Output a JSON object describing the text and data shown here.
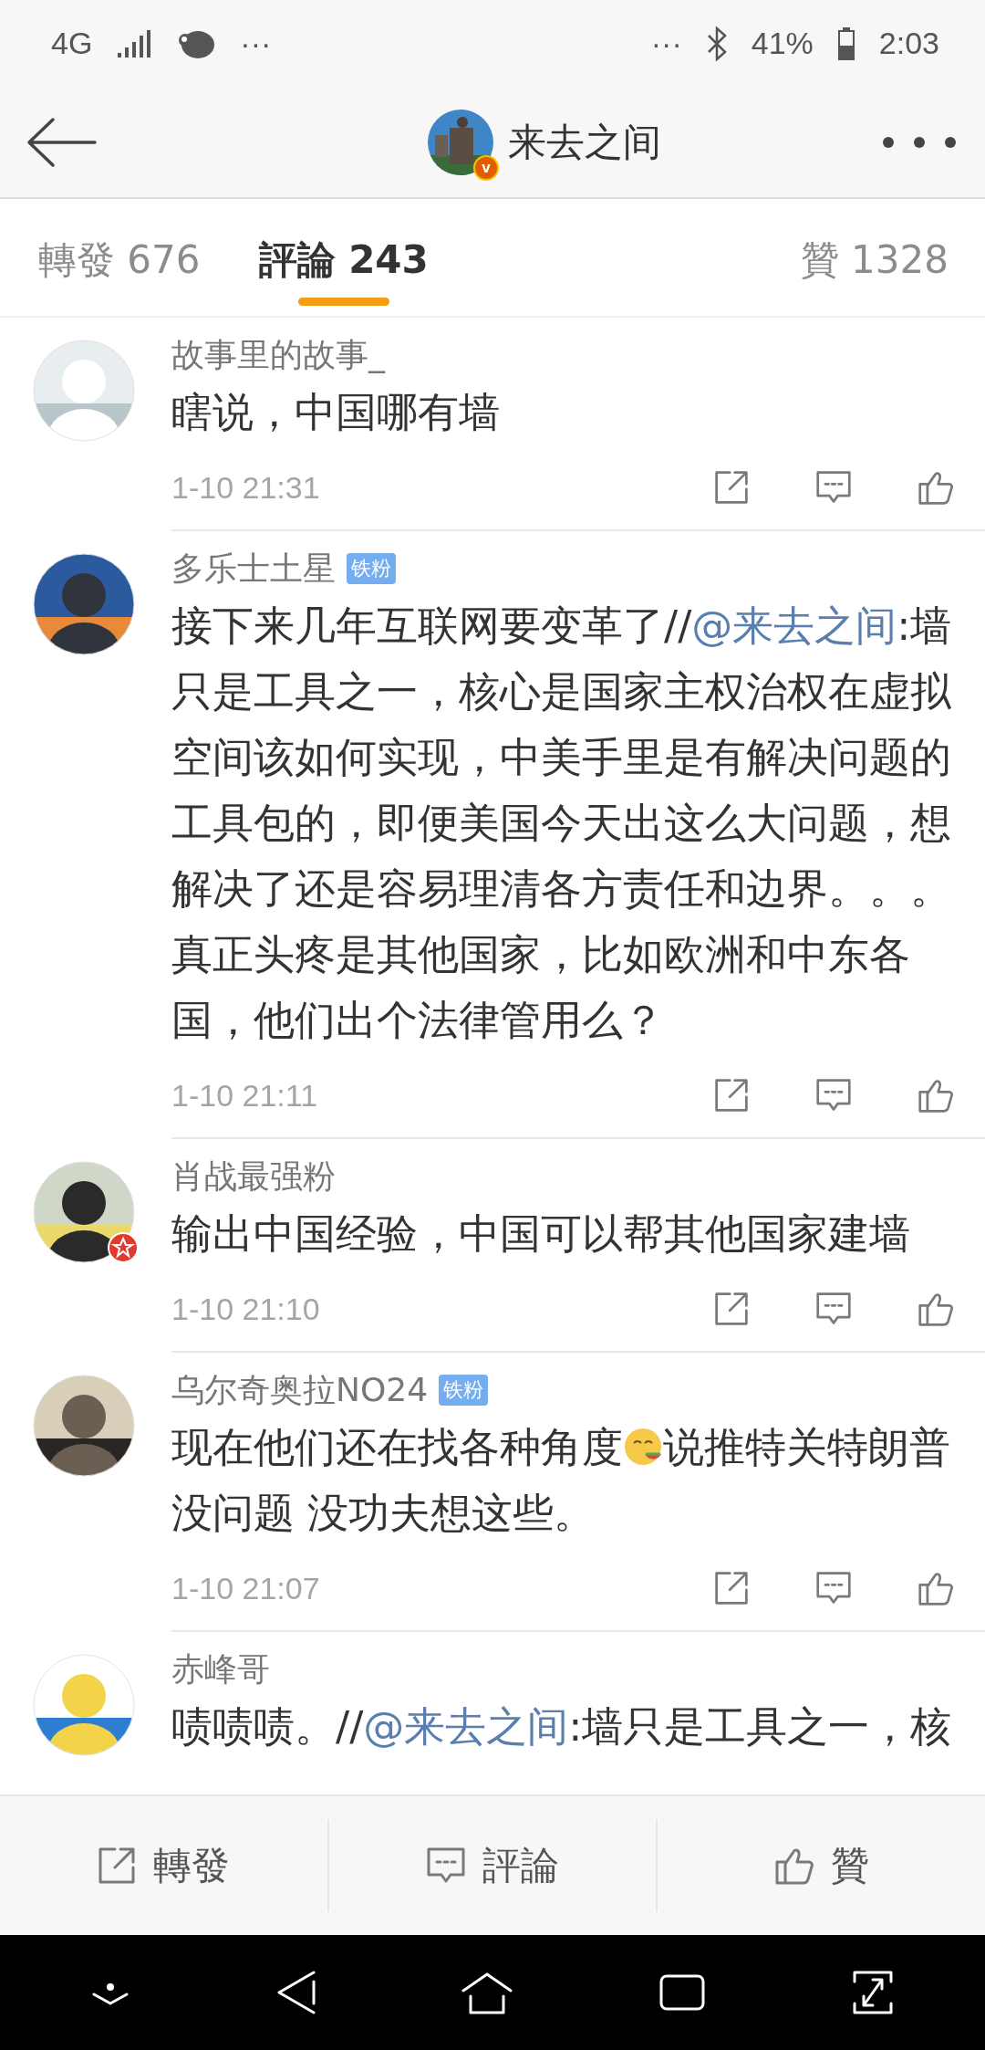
{
  "status_bar": {
    "network": "4G",
    "left_more": "···",
    "right_more": "···",
    "battery": "41%",
    "time": "2:03"
  },
  "header": {
    "title": "来去之间",
    "verified_mark": "v"
  },
  "tabs": [
    {
      "label": "轉發 676",
      "selected": false
    },
    {
      "label": "評論 243",
      "selected": true
    },
    {
      "label": "贊 1328",
      "selected": false
    }
  ],
  "comments": [
    {
      "name": "故事里的故事_",
      "avatar_badge": false,
      "time": "1-10 21:31",
      "body": [
        {
          "kind": "text",
          "text": "瞎说，中国哪有墙"
        }
      ]
    },
    {
      "name": "多乐士土星",
      "badge": "铁粉",
      "avatar_badge": false,
      "time": "1-10 21:11",
      "body": [
        {
          "kind": "text",
          "text": "接下来几年互联网要变革了//"
        },
        {
          "kind": "mention",
          "text": "@来去之间"
        },
        {
          "kind": "text",
          "text": ":墙只是工具之一，核心是国家主权治权在虚拟空间该如何实现，中美手里是有解决问题的工具包的，即便美国今天出这么大问题，想解决了还是容易理清各方责任和边界。。。真正头疼是其他国家，比如欧洲和中东各国，他们出个法律管用么？"
        }
      ]
    },
    {
      "name": "肖战最强粉",
      "avatar_badge": true,
      "time": "1-10 21:10",
      "body": [
        {
          "kind": "text",
          "text": "输出中国经验，中国可以帮其他国家建墙"
        }
      ]
    },
    {
      "name": "乌尔奇奥拉NO24",
      "badge": "铁粉",
      "avatar_badge": false,
      "time": "1-10 21:07",
      "body": [
        {
          "kind": "text",
          "text": "现在他们还在找各种角度"
        },
        {
          "kind": "emoji"
        },
        {
          "kind": "text",
          "text": "说推特关特朗普没问题 没功夫想这些。"
        }
      ]
    },
    {
      "name": "赤峰哥",
      "avatar_badge": false,
      "body": [
        {
          "kind": "text",
          "text": "啧啧啧。//"
        },
        {
          "kind": "mention",
          "text": "@来去之间"
        },
        {
          "kind": "text",
          "text": ":墙只是工具之一，核"
        }
      ]
    }
  ],
  "bottom_bar": [
    {
      "kind": "repost",
      "label": "轉發"
    },
    {
      "kind": "comment",
      "label": "評論"
    },
    {
      "kind": "like",
      "label": "贊"
    }
  ]
}
